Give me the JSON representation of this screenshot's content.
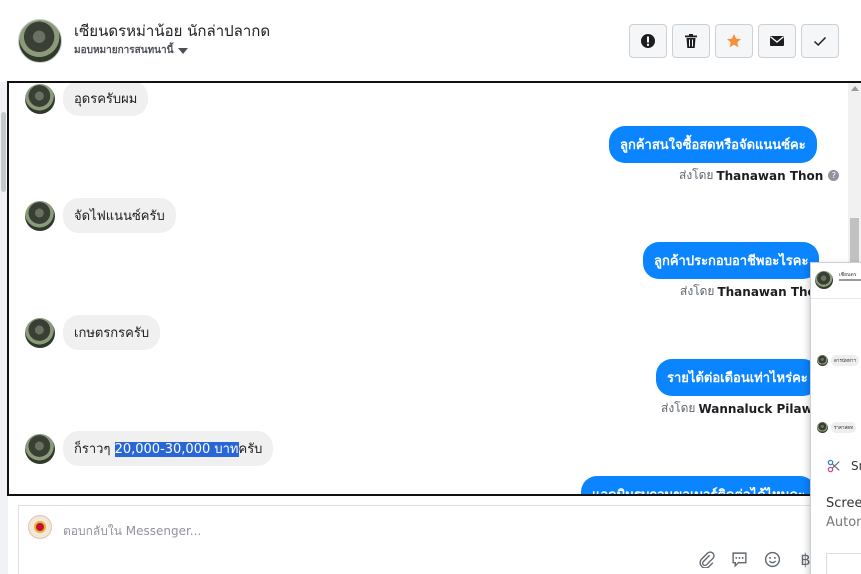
{
  "header": {
    "contact_name": "เซียนดรหม่าน้อย นักล่าปลากด",
    "assign_label": "มอบหมายการสนทนานี้",
    "actions": [
      {
        "name": "mark-spam-button",
        "icon": "alert-icon"
      },
      {
        "name": "delete-button",
        "icon": "trash-icon"
      },
      {
        "name": "star-button",
        "icon": "star-icon"
      },
      {
        "name": "mark-unread-button",
        "icon": "envelope-icon"
      },
      {
        "name": "mark-done-button",
        "icon": "check-icon"
      }
    ],
    "star_color": "#f7923b"
  },
  "messages": [
    {
      "dir": "in",
      "text": "อุดรครับผม"
    },
    {
      "dir": "out",
      "text": "ลูกค้าสนใจซื้อสดหรือจัดแนนซ์คะ",
      "sent_by_label": "ส่งโดย",
      "sender": "Thanawan Thon"
    },
    {
      "dir": "in",
      "text": "จัดไฟแนนซ์ครับ"
    },
    {
      "dir": "out",
      "text": "ลูกค้าประกอบอาชีพอะไรคะ",
      "sent_by_label": "ส่งโดย",
      "sender": "Thanawan Thon"
    },
    {
      "dir": "in",
      "text": "เกษตรกรครับ"
    },
    {
      "dir": "out",
      "text": "รายได้ต่อเดือนเท่าไหร่คะ",
      "sent_by_label": "ส่งโดย",
      "sender": "Wannaluck Pilawan"
    },
    {
      "dir": "in",
      "text_before": "ก็ราวๆ ",
      "text_highlight": "20,000-30,000 บาท",
      "text_after": "ครับ"
    },
    {
      "dir": "out",
      "text": "แอดมินรบกวนขอเบอร์ติดต่อได้ไหมคะ"
    }
  ],
  "composer": {
    "placeholder": "ตอบกลับใน Messenger...",
    "icons": [
      "attachment-icon",
      "saved-replies-icon",
      "emoji-icon",
      "baht-icon"
    ]
  },
  "popup": {
    "snip_label": "Sn",
    "line1": "Screen",
    "line2": "Autom",
    "mini_title": "เซียนดร",
    "mini_msg1": "ดารนัทท่าฯ",
    "mini_msg2": "ราคาสดท"
  },
  "colors": {
    "bubble_out": "#0a84ff",
    "bubble_in": "#f0f0f0",
    "highlight": "#2866d6"
  }
}
